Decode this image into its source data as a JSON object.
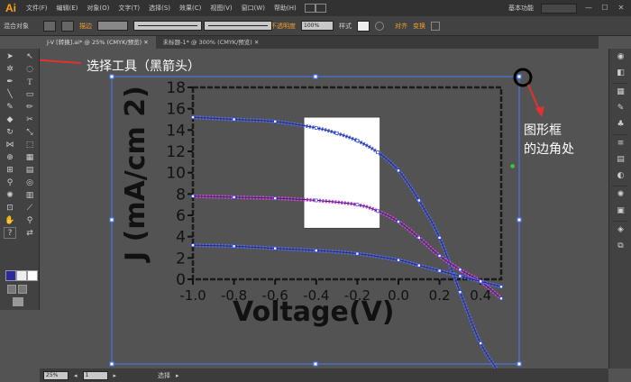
{
  "menubar": {
    "logo": "Ai",
    "items": [
      "文件(F)",
      "编辑(E)",
      "对象(O)",
      "文字(T)",
      "选择(S)",
      "效果(C)",
      "视图(V)",
      "窗口(W)",
      "帮助(H)"
    ],
    "workspace": "基本功能",
    "window_buttons": [
      "—",
      "☐",
      "✕"
    ]
  },
  "controlbar": {
    "mode_label": "混合对象",
    "stroke_label": "描边",
    "stroke_style_1": "等比",
    "stroke_style_2": "基本",
    "opacity_label": "不透明度",
    "opacity_value": "100%",
    "style_label": "样式",
    "align_label": "对齐",
    "transform_label": "变换"
  },
  "tabs": [
    {
      "label": "J-V [转换].ai* @ 25% (CMYK/预览)  ✕",
      "active": true
    },
    {
      "label": "未标题-1* @ 300% (CMYK/预览)  ✕",
      "active": false
    }
  ],
  "statusbar": {
    "zoom": "25%",
    "page": "1",
    "status_text": "选择"
  },
  "annotations": {
    "select_tool": "选择工具（黑箭头）",
    "corner_line1": "图形框",
    "corner_line2": "的边角处",
    "colors": {
      "arrow": "#e53030",
      "circle": "#000000",
      "text": "#ffffff"
    }
  },
  "chart_data": {
    "type": "line",
    "xlabel": "Voltage(V)",
    "ylabel": "J (mA/cm 2)",
    "xlim": [
      -1.0,
      0.5
    ],
    "ylim": [
      0,
      18
    ],
    "xticks": [
      "-1.0",
      "-0.8",
      "-0.6",
      "-0.4",
      "-0.2",
      "0.0",
      "0.2",
      "0.4"
    ],
    "yticks": [
      "0",
      "2",
      "4",
      "6",
      "8",
      "10",
      "12",
      "14",
      "16",
      "18"
    ],
    "series": [
      {
        "color": "#4d6bff",
        "x": [
          -1.0,
          -0.8,
          -0.6,
          -0.4,
          -0.3,
          -0.2,
          -0.1,
          0.0,
          0.1,
          0.2,
          0.3,
          0.4,
          0.5
        ],
        "y": [
          15.2,
          15.0,
          14.8,
          14.2,
          13.7,
          13.0,
          11.9,
          10.2,
          7.4,
          3.9,
          -1.2,
          -6.0,
          -9.0
        ]
      },
      {
        "color": "#e040e0",
        "x": [
          -1.0,
          -0.8,
          -0.6,
          -0.4,
          -0.2,
          -0.1,
          0.0,
          0.1,
          0.2,
          0.3,
          0.4,
          0.5
        ],
        "y": [
          7.8,
          7.7,
          7.6,
          7.4,
          7.0,
          6.4,
          5.4,
          3.9,
          2.2,
          0.9,
          -0.2,
          -1.8
        ]
      },
      {
        "color": "#4d6bff",
        "x": [
          -1.0,
          -0.8,
          -0.6,
          -0.4,
          -0.2,
          0.0,
          0.1,
          0.2,
          0.3,
          0.4,
          0.5
        ],
        "y": [
          3.2,
          3.1,
          2.9,
          2.7,
          2.4,
          1.8,
          1.3,
          0.8,
          0.3,
          -0.2,
          -0.7
        ]
      }
    ],
    "inset": {
      "x_range": [
        -0.46,
        -0.09
      ],
      "y_range": [
        4.8,
        15.2
      ],
      "fill": "#ffffff"
    }
  }
}
